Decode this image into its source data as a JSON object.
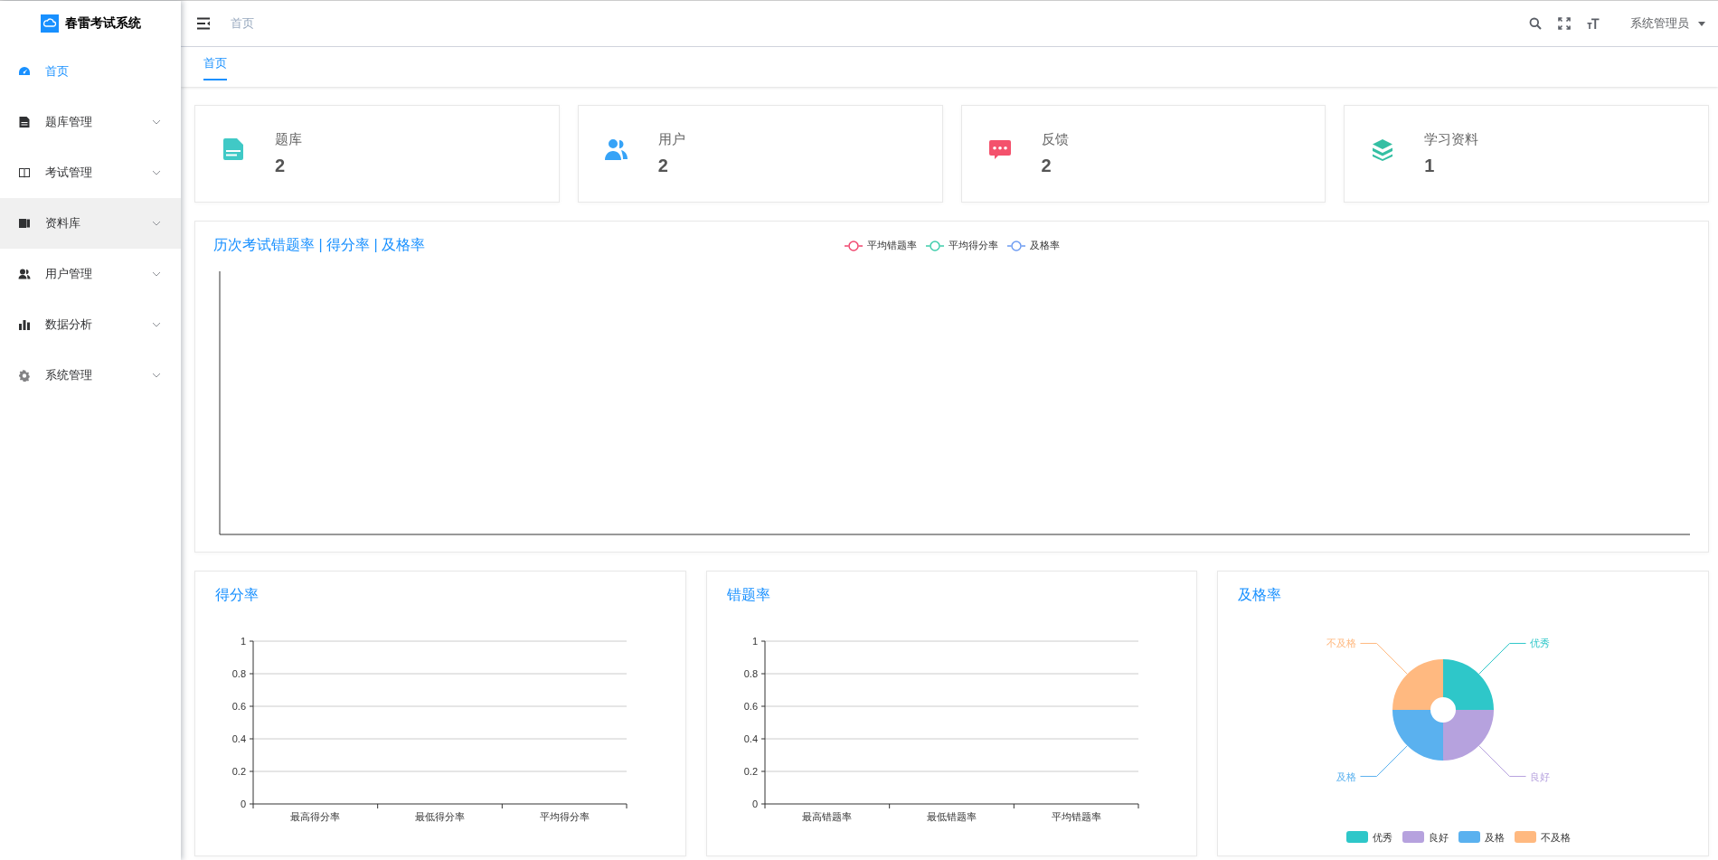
{
  "app": {
    "title": "春雷考试系统"
  },
  "sidebar": {
    "items": [
      {
        "label": "首页",
        "kind": "link",
        "selected": true,
        "hovered": false
      },
      {
        "label": "题库管理",
        "kind": "submenu",
        "selected": false,
        "hovered": false
      },
      {
        "label": "考试管理",
        "kind": "submenu",
        "selected": false,
        "hovered": false
      },
      {
        "label": "资料库",
        "kind": "submenu",
        "selected": false,
        "hovered": true
      },
      {
        "label": "用户管理",
        "kind": "submenu",
        "selected": false,
        "hovered": false
      },
      {
        "label": "数据分析",
        "kind": "submenu",
        "selected": false,
        "hovered": false
      },
      {
        "label": "系统管理",
        "kind": "submenu",
        "selected": false,
        "hovered": false
      }
    ]
  },
  "topbar": {
    "breadcrumb": "首页",
    "user": "系统管理员"
  },
  "tabs": [
    {
      "label": "首页",
      "selected": true
    }
  ],
  "stats": [
    {
      "label": "题库",
      "value": "2",
      "color": "#40c9c6"
    },
    {
      "label": "用户",
      "value": "2",
      "color": "#36a3f7"
    },
    {
      "label": "反馈",
      "value": "2",
      "color": "#f4516c"
    },
    {
      "label": "学习资料",
      "value": "1",
      "color": "#34bfa3"
    }
  ],
  "trend_chart": {
    "title": "历次考试错题率 | 得分率 | 及格率",
    "legend": [
      {
        "name": "平均错题率",
        "color": "#f0466f"
      },
      {
        "name": "平均得分率",
        "color": "#3ecdab"
      },
      {
        "name": "及格率",
        "color": "#6e9cf2"
      }
    ]
  },
  "score_chart": {
    "chart_data": {
      "type": "bar",
      "title": "得分率",
      "categories": [
        "最高得分率",
        "最低得分率",
        "平均得分率"
      ],
      "values": [
        null,
        null,
        null
      ],
      "ylim": [
        0,
        1
      ],
      "yticks": [
        0,
        0.2,
        0.4,
        0.6,
        0.8,
        1
      ],
      "grid": true
    }
  },
  "error_chart": {
    "chart_data": {
      "type": "bar",
      "title": "错题率",
      "categories": [
        "最高错题率",
        "最低错题率",
        "平均错题率"
      ],
      "values": [
        null,
        null,
        null
      ],
      "ylim": [
        0,
        1
      ],
      "yticks": [
        0,
        0.2,
        0.4,
        0.6,
        0.8,
        1
      ],
      "grid": true
    }
  },
  "pass_chart": {
    "chart_data": {
      "type": "donut",
      "title": "及格率",
      "categories": [
        "优秀",
        "良好",
        "及格",
        "不及格"
      ],
      "values": [
        25,
        25,
        25,
        25
      ],
      "colors": [
        "#2ec7c9",
        "#b6a2de",
        "#5ab1ef",
        "#ffb980"
      ],
      "legend": true
    }
  }
}
